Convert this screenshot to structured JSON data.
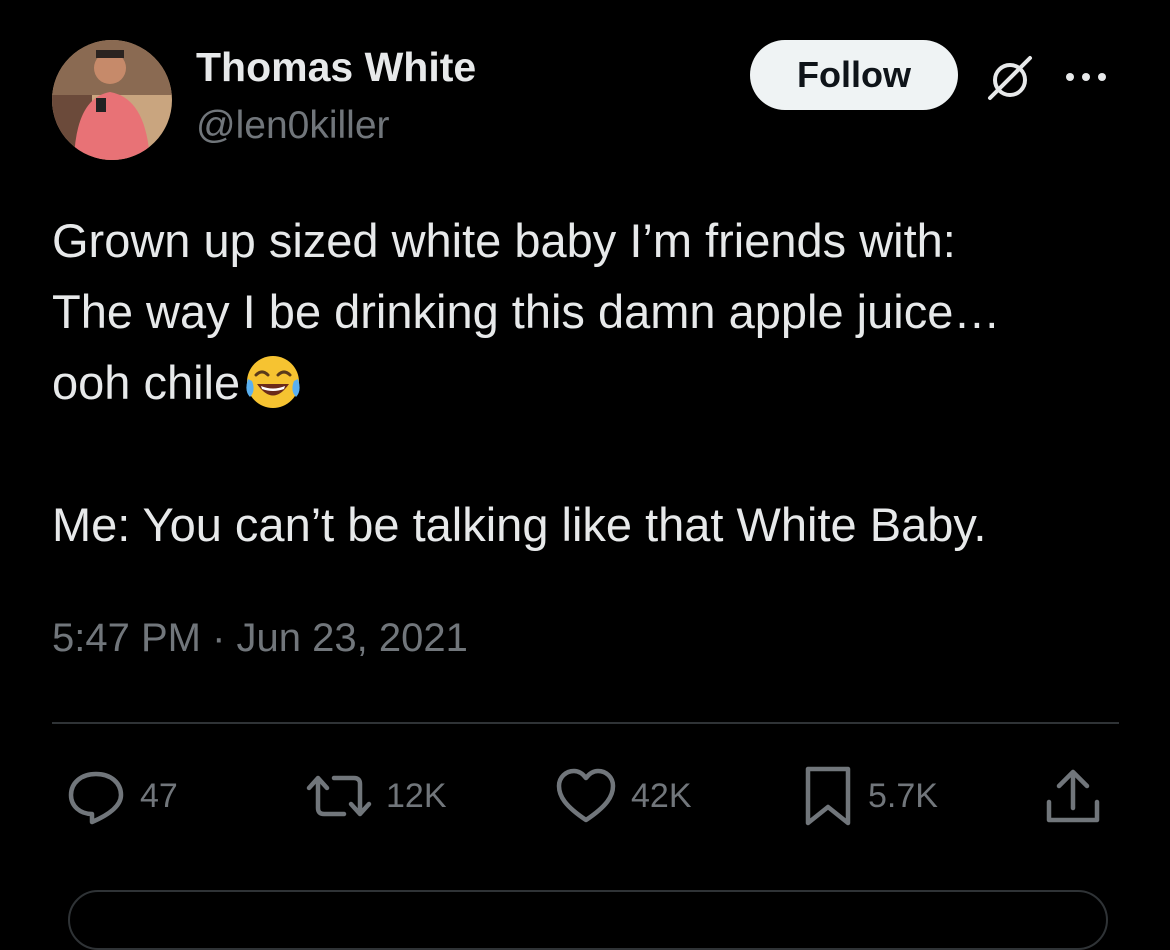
{
  "author": {
    "name": "Thomas White",
    "handle": "@len0killer"
  },
  "follow_label": "Follow",
  "tweet": {
    "lines": [
      "Grown up sized white baby I’m friends with:",
      "The way I be drinking this damn apple juice…",
      "ooh chile"
    ],
    "line_emoji": "face-with-tears-of-joy-icon",
    "reply_line": "Me: You can’t be talking like that White Baby."
  },
  "timestamp": "5:47 PM · Jun 23, 2021",
  "actions": {
    "replies": "47",
    "reposts": "12K",
    "likes": "42K",
    "bookmarks": "5.7K"
  },
  "icons": [
    "grok-icon",
    "more-icon",
    "reply-icon",
    "repost-icon",
    "like-icon",
    "bookmark-icon",
    "share-icon"
  ],
  "colors": {
    "background": "#000000",
    "text": "#e7e9ea",
    "secondary": "#71767b",
    "button_bg": "#eff3f4"
  }
}
